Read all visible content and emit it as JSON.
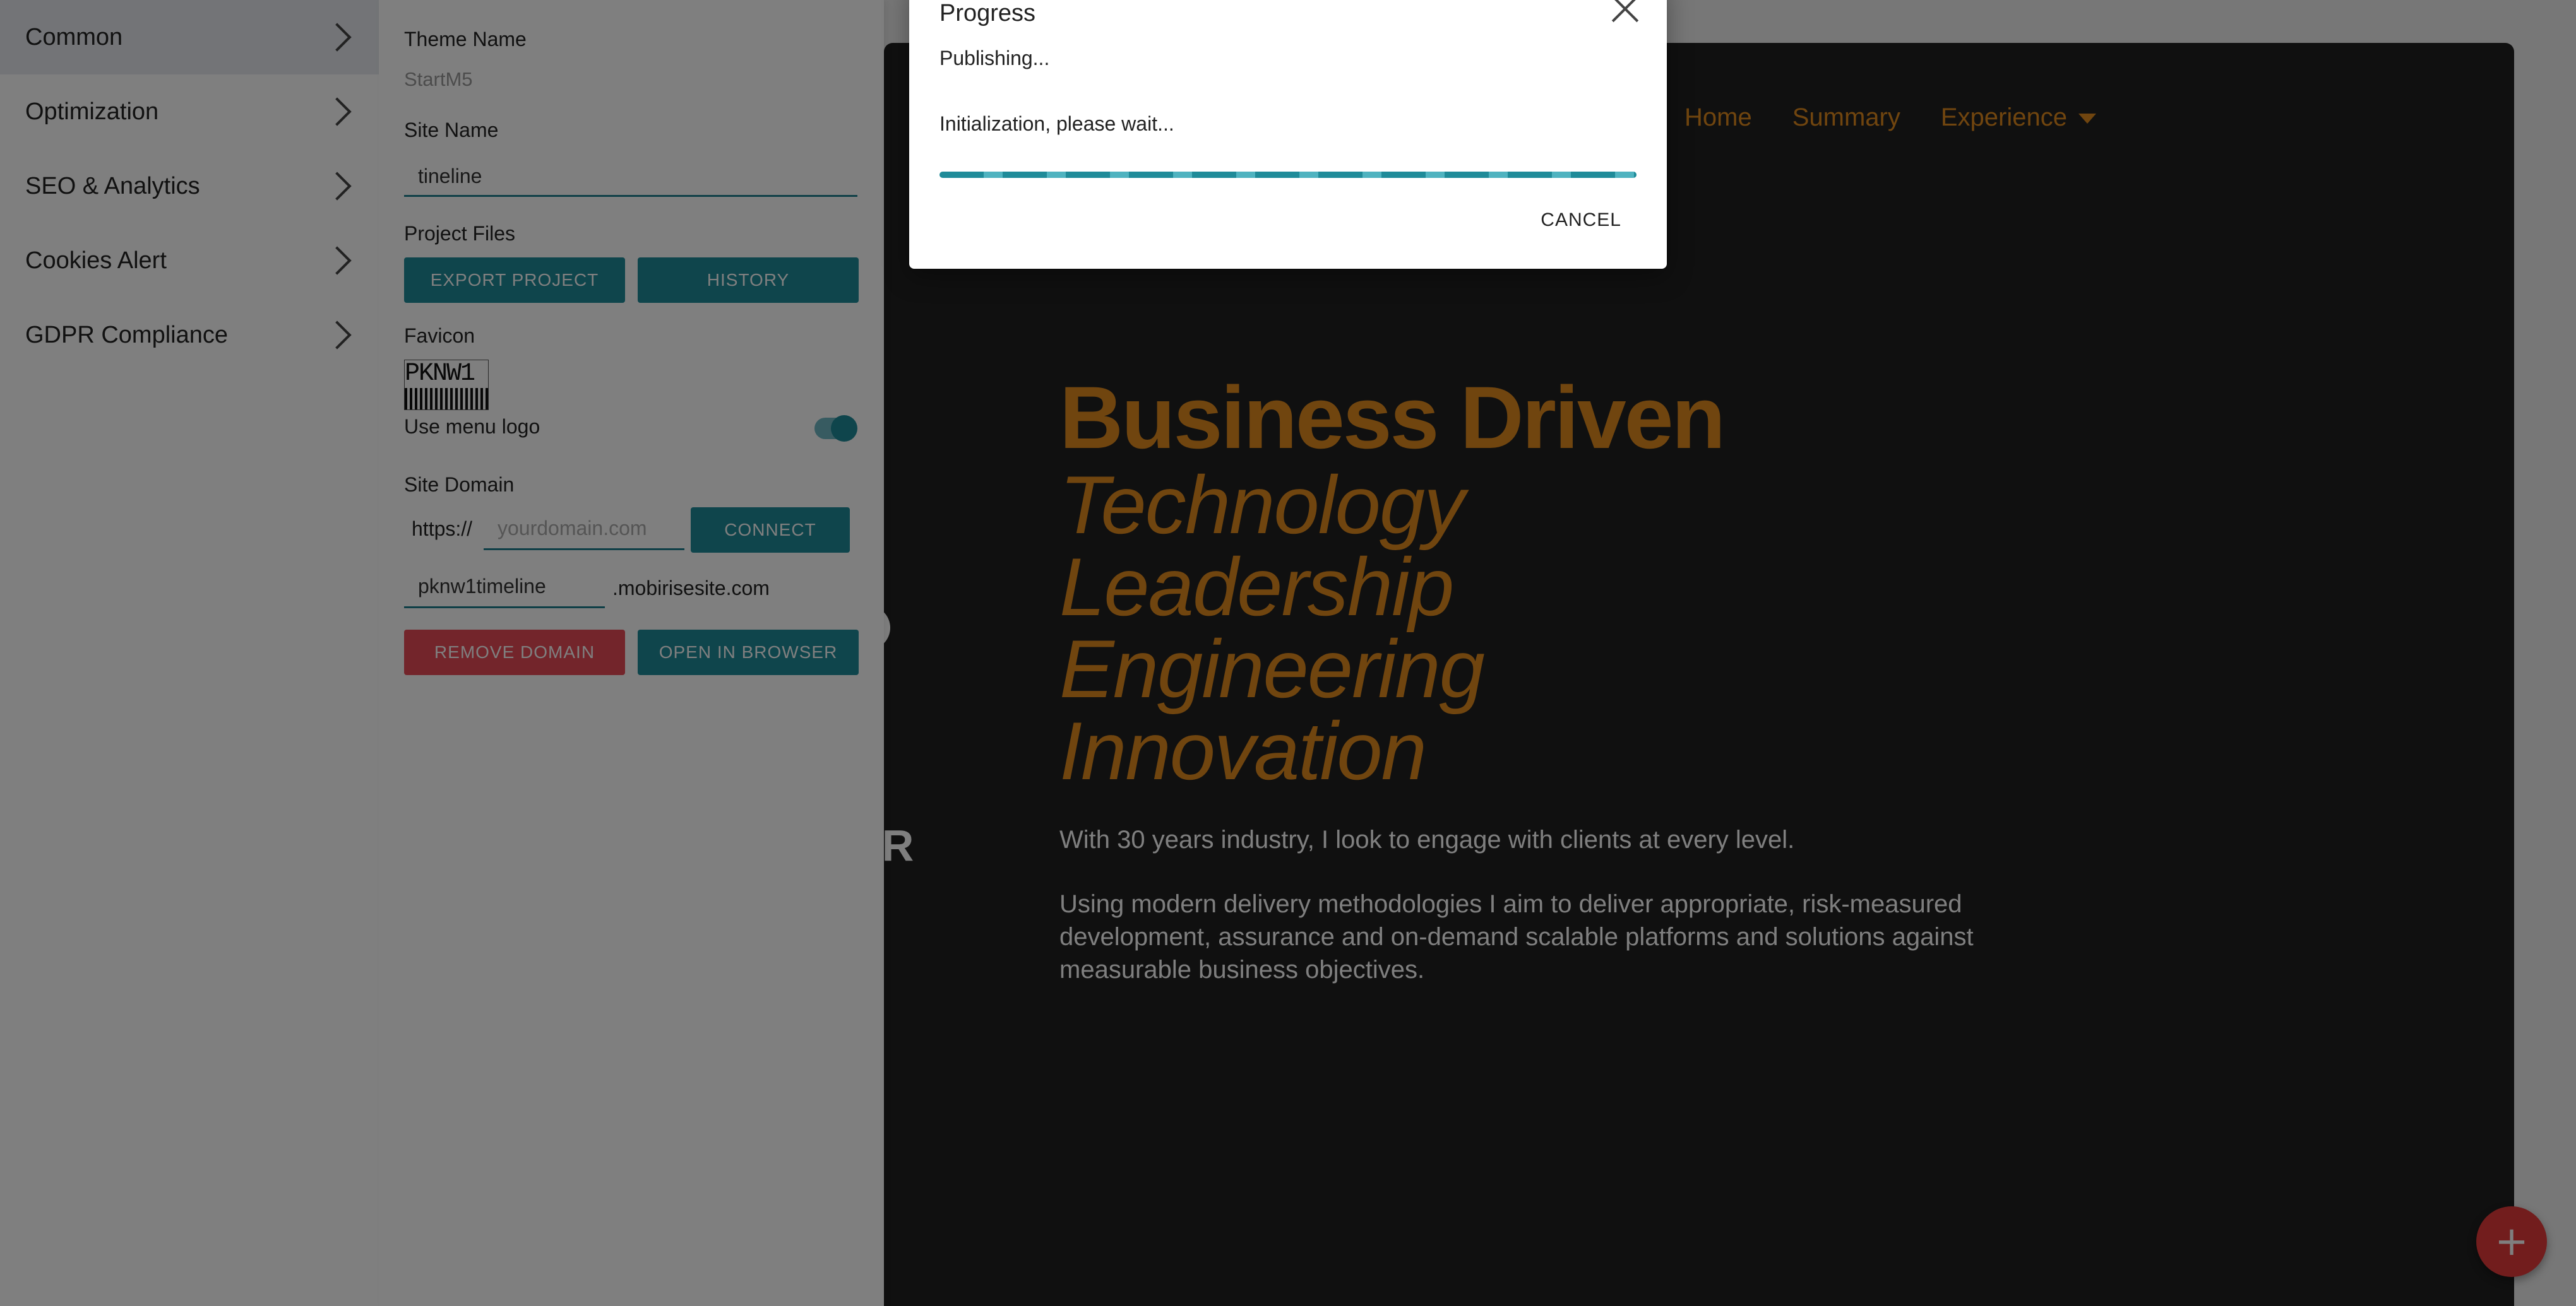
{
  "menu": {
    "items": [
      {
        "label": "Common",
        "active": true
      },
      {
        "label": "Optimization"
      },
      {
        "label": "SEO & Analytics"
      },
      {
        "label": "Cookies Alert"
      },
      {
        "label": "GDPR Compliance"
      }
    ]
  },
  "settings": {
    "theme_name_label": "Theme Name",
    "theme_name_value": "StartM5",
    "site_name_label": "Site Name",
    "site_name_value": "tineline",
    "project_files_label": "Project Files",
    "export_button": "EXPORT PROJECT",
    "history_button": "HISTORY",
    "favicon_label": "Favicon",
    "favicon_text": "PKNW1",
    "use_menu_logo_label": "Use menu logo",
    "use_menu_logo_on": true,
    "site_domain_label": "Site Domain",
    "protocol": "https://",
    "domain_placeholder": "yourdomain.com",
    "connect_button": "CONNECT",
    "subdomain_value": "pknw1timeline",
    "subdomain_suffix": ".mobirisesite.com",
    "remove_domain_button": "REMOVE DOMAIN",
    "open_browser_button": "OPEN IN BROWSER"
  },
  "site": {
    "nav": [
      "Home",
      "Summary",
      "Experience"
    ],
    "hero_title": "Business Driven",
    "hero_lines": [
      "Technology",
      "Leadership",
      "Engineering",
      "Innovation"
    ],
    "paragraph1": "With 30 years industry, I look to engage with clients at every level.",
    "paragraph2": "Using modern delivery methodologies I aim to deliver appropriate, risk-measured development, assurance and on-demand scalable platforms and solutions against measurable business objectives.",
    "background_fragment": "ER",
    "accent_color": "#e08a1e"
  },
  "dialog": {
    "title": "Progress",
    "status": "Publishing...",
    "message": "Initialization, please wait...",
    "cancel": "CANCEL"
  },
  "colors": {
    "teal": "#1f8b99",
    "red": "#e64b57",
    "accent": "#e08a1e"
  }
}
